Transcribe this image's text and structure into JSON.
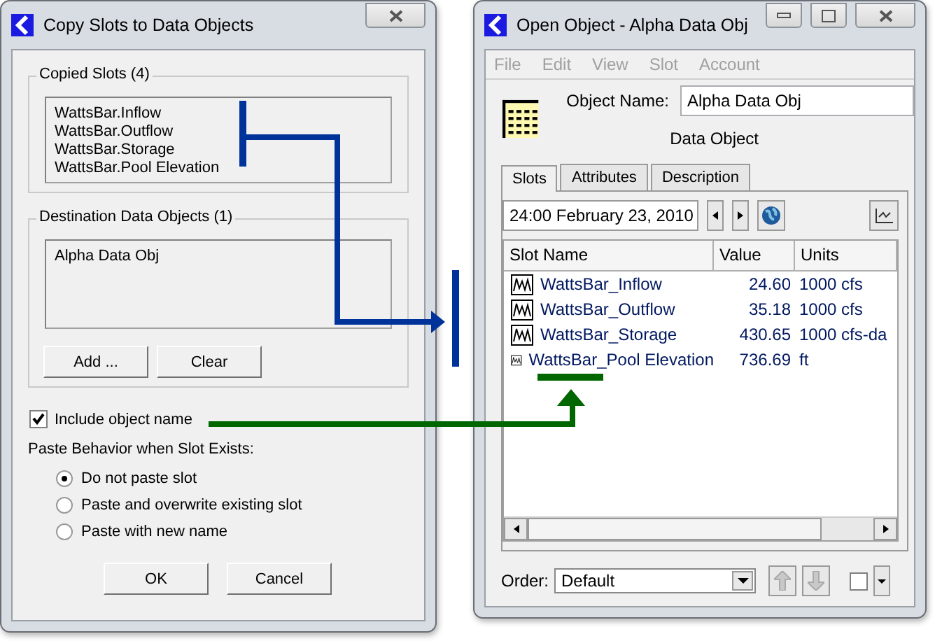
{
  "copy_dialog": {
    "title": "Copy Slots to Data Objects",
    "copied_slots": {
      "label": "Copied Slots (4)",
      "items": [
        "WattsBar.Inflow",
        "WattsBar.Outflow",
        "WattsBar.Storage",
        "WattsBar.Pool Elevation"
      ]
    },
    "destination": {
      "label": "Destination Data Objects (1)",
      "items": [
        "Alpha Data Obj"
      ],
      "buttons": [
        "Add ...",
        "Clear"
      ]
    },
    "include_object_name": {
      "label": "Include object name",
      "checked": true
    },
    "paste_behavior": {
      "label": "Paste Behavior when Slot Exists:",
      "options": [
        {
          "label": "Do not paste slot",
          "selected": true
        },
        {
          "label": "Paste and overwrite existing slot",
          "selected": false
        },
        {
          "label": "Paste with new name",
          "selected": false
        }
      ]
    },
    "buttons": [
      "OK",
      "Cancel"
    ]
  },
  "open_object": {
    "title": "Open Object - Alpha Data Obj",
    "menu": [
      {
        "label": "File",
        "disabled": true
      },
      {
        "label": "Edit",
        "disabled": true
      },
      {
        "label": "View",
        "disabled": true
      },
      {
        "label": "Slot",
        "disabled": true
      },
      {
        "label": "Account",
        "disabled": true
      }
    ],
    "object_name_label": "Object Name:",
    "object_name": "Alpha Data Obj",
    "object_type": "Data Object",
    "tabs": [
      {
        "label": "Slots",
        "selected": true
      },
      {
        "label": "Attributes",
        "selected": false
      },
      {
        "label": "Description",
        "selected": false
      }
    ],
    "date": "24:00 February 23, 2010",
    "table": {
      "columns": [
        "Slot Name",
        "Value",
        "Units"
      ],
      "rows": [
        {
          "name": "WattsBar_Inflow",
          "value": "24.60",
          "units": "1000 cfs"
        },
        {
          "name": "WattsBar_Outflow",
          "value": "35.18",
          "units": "1000 cfs"
        },
        {
          "name": "WattsBar_Storage",
          "value": "430.65",
          "units": "1000 cfs-da"
        },
        {
          "name": "WattsBar_Pool Elevation",
          "value": "736.69",
          "units": "ft"
        }
      ]
    },
    "order_label": "Order:",
    "order": "Default",
    "order_toggle": {
      "checked": false
    }
  }
}
